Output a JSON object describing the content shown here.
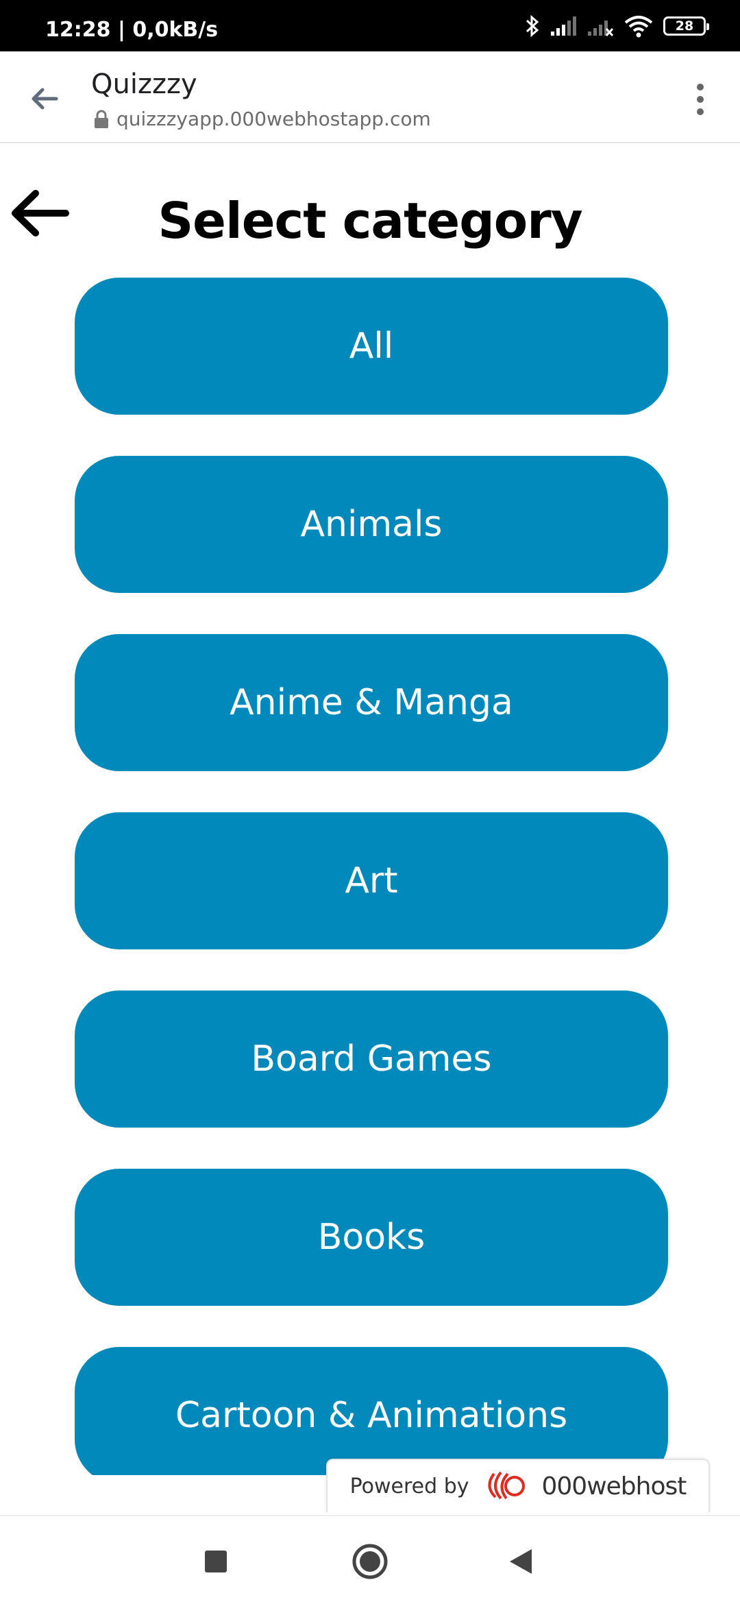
{
  "status_bar": {
    "time": "12:28 | 0,0kB/s",
    "battery": "28",
    "icons": [
      "bluetooth-icon",
      "signal-icon",
      "signal-no-service-icon",
      "wifi-icon",
      "battery-icon"
    ]
  },
  "browser": {
    "title": "Quizzzy",
    "url": "quizzzyapp.000webhostapp.com",
    "icons": [
      "back-arrow-icon",
      "lock-icon",
      "more-vert-icon"
    ]
  },
  "page": {
    "title": "Select category",
    "back_icon": "back-arrow-icon",
    "categories": [
      "All",
      "Animals",
      "Anime & Manga",
      "Art",
      "Board Games",
      "Books",
      "Cartoon & Animations"
    ]
  },
  "badge": {
    "powered_by": "Powered by",
    "brand": "000webhost"
  },
  "nav": {
    "icons": [
      "recents-square-icon",
      "home-circle-icon",
      "back-triangle-icon"
    ]
  },
  "colors": {
    "button_bg": "#0289bb",
    "button_text": "#ffffff",
    "brand_accent": "#e02b20"
  }
}
